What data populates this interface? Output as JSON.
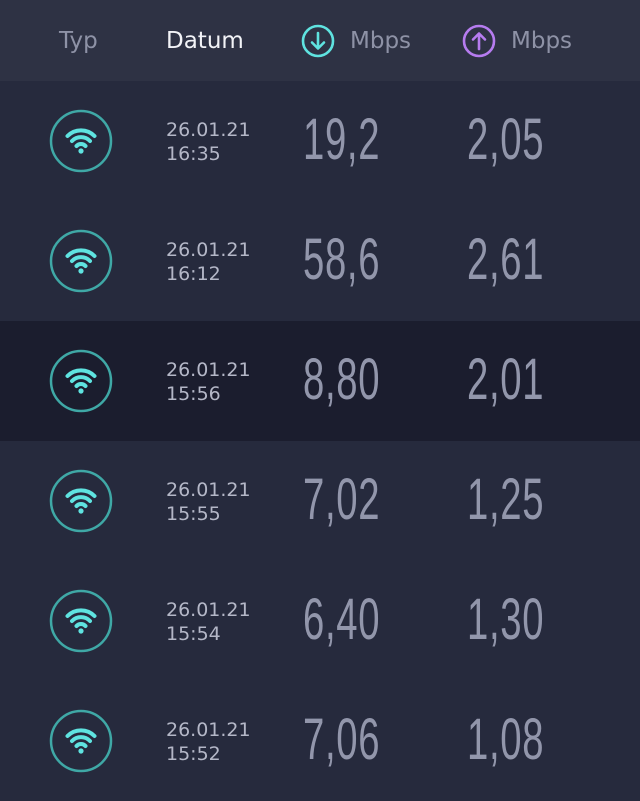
{
  "header": {
    "type_label": "Typ",
    "date_label": "Datum",
    "download_unit": "Mbps",
    "upload_unit": "Mbps",
    "download_icon": "arrow-down-circle-icon",
    "upload_icon": "arrow-up-circle-icon",
    "download_color": "#5fe3e0",
    "upload_color": "#b67cf0"
  },
  "results": [
    {
      "icon": "wifi-icon",
      "date": "26.01.21",
      "time": "16:35",
      "download": "19,2",
      "upload": "2,05",
      "selected": false
    },
    {
      "icon": "wifi-icon",
      "date": "26.01.21",
      "time": "16:12",
      "download": "58,6",
      "upload": "2,61",
      "selected": false
    },
    {
      "icon": "wifi-icon",
      "date": "26.01.21",
      "time": "15:56",
      "download": "8,80",
      "upload": "2,01",
      "selected": true
    },
    {
      "icon": "wifi-icon",
      "date": "26.01.21",
      "time": "15:55",
      "download": "7,02",
      "upload": "1,25",
      "selected": false
    },
    {
      "icon": "wifi-icon",
      "date": "26.01.21",
      "time": "15:54",
      "download": "6,40",
      "upload": "1,30",
      "selected": false
    },
    {
      "icon": "wifi-icon",
      "date": "26.01.21",
      "time": "15:52",
      "download": "7,06",
      "upload": "1,08",
      "selected": false
    }
  ]
}
